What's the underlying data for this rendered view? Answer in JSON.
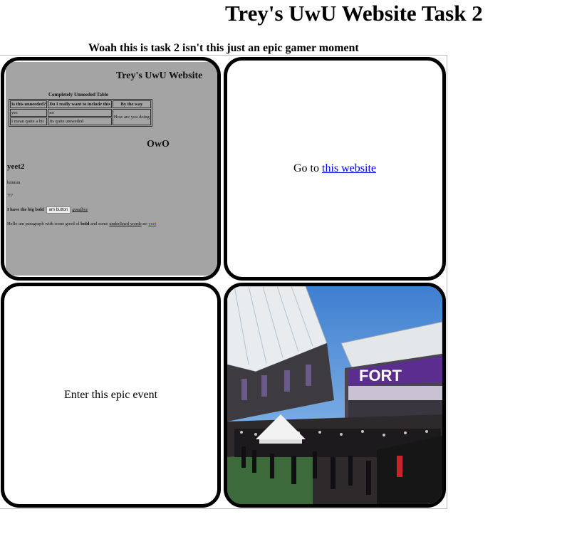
{
  "header": {
    "title": "Trey's UwU Website Task 2",
    "subtitle": "Woah this is task 2 isn't this just an epic gamer moment"
  },
  "preview": {
    "title": "Trey's UwU Website",
    "table_caption": "Completely Unneeded Table",
    "headers": [
      "Is this unneeded?",
      "Do I really want to include this",
      "By the way"
    ],
    "rows": [
      [
        "yes",
        "no",
        "How are you doing"
      ],
      [
        "I mean quite a bit",
        "Its quite unneeded"
      ]
    ],
    "owo": "OwO",
    "yeet": "yeet2",
    "hmm": "hmmm",
    "question": "?!?",
    "bold_text": "I have the big bold",
    "button_label": "am button",
    "goodbye": "goodbye",
    "para": {
      "p1": "Hello am paragraph with some good ol ",
      "bold": "bold",
      "p2": " and some ",
      "underlined": "underlined words",
      "p3": " no ",
      "link": "yeet"
    }
  },
  "cell2": {
    "prefix": "Go to ",
    "link": "this website"
  },
  "cell3": {
    "text": "Enter this epic event"
  },
  "cell4": {
    "banner": "FORT"
  }
}
